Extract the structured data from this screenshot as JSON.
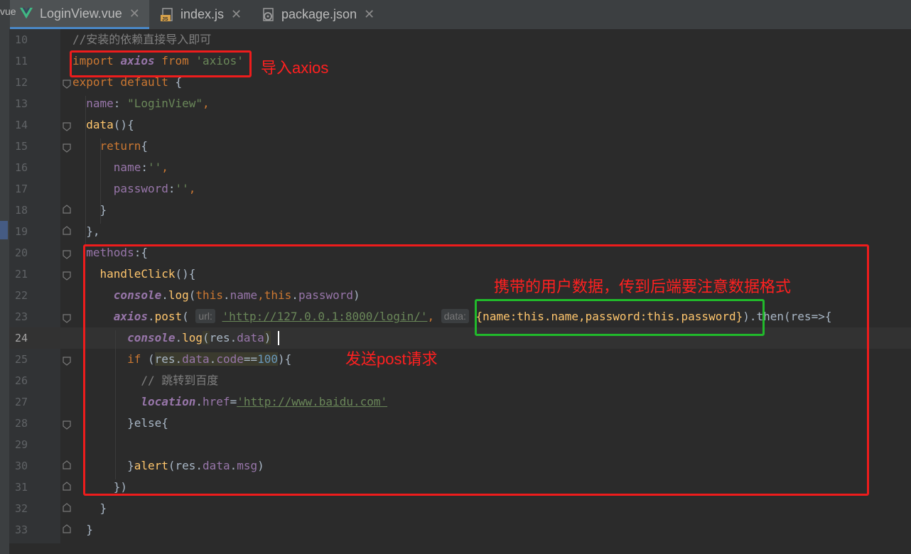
{
  "tabs": [
    {
      "label": "LoginView.vue",
      "icon": "vue-icon",
      "active": true
    },
    {
      "label": "index.js",
      "icon": "js-file-icon",
      "active": false
    },
    {
      "label": "package.json",
      "icon": "package-json-icon",
      "active": false
    }
  ],
  "left_strip_hint": "vue",
  "annotations": {
    "import_note": "导入axios",
    "data_note": "携带的用户数据，传到后端要注意数据格式",
    "post_note": "发送post请求"
  },
  "colors": {
    "annotation": "#ee1c1c",
    "green_box": "#21b92b",
    "accent": "#4a88c7"
  },
  "lines": [
    {
      "num": "10"
    },
    {
      "num": "11"
    },
    {
      "num": "12"
    },
    {
      "num": "13"
    },
    {
      "num": "14"
    },
    {
      "num": "15"
    },
    {
      "num": "16"
    },
    {
      "num": "17"
    },
    {
      "num": "18"
    },
    {
      "num": "19"
    },
    {
      "num": "20"
    },
    {
      "num": "21"
    },
    {
      "num": "22"
    },
    {
      "num": "23"
    },
    {
      "num": "24"
    },
    {
      "num": "25"
    },
    {
      "num": "26"
    },
    {
      "num": "27"
    },
    {
      "num": "28"
    },
    {
      "num": "29"
    },
    {
      "num": "30"
    },
    {
      "num": "31"
    },
    {
      "num": "32"
    },
    {
      "num": "33"
    }
  ],
  "code": {
    "l10": "//安装的依赖直接导入即可",
    "l11": [
      "import",
      "axios",
      "from",
      "'axios'"
    ],
    "l12": [
      "export",
      "default",
      "{"
    ],
    "l13": [
      "name",
      ": ",
      "\"LoginView\"",
      ","
    ],
    "l14": [
      "data",
      "(){"
    ],
    "l15": [
      "return",
      "{"
    ],
    "l16": [
      "name",
      ":",
      "''",
      ","
    ],
    "l17": [
      "password",
      ":",
      "''",
      ","
    ],
    "l18": "}",
    "l19": "},",
    "l20": [
      "methods",
      ":{"
    ],
    "l21": [
      "handleClick",
      "(){"
    ],
    "l22": [
      "console",
      ".",
      "log",
      "(",
      "this",
      ".",
      "name",
      ",",
      "this",
      ".",
      "password",
      ")"
    ],
    "l23": {
      "obj": "axios",
      "fn": "post",
      "url_hint": "url:",
      "url": "'http://127.0.0.1:8000/login/'",
      "data_hint": "data:",
      "body": "{name:this.name,password:this.password}",
      "then": ").then(res=>{"
    },
    "l24": [
      "console",
      ".",
      "log",
      "(",
      "res",
      ".",
      "data",
      ")"
    ],
    "l25": [
      "if",
      " (",
      "res",
      ".",
      "data",
      ".",
      "code",
      "==",
      "100",
      "){"
    ],
    "l26": "// 跳转到百度",
    "l27": [
      "location",
      ".",
      "href",
      "=",
      "'http://www.baidu.com'"
    ],
    "l28": "}else{",
    "l29": "",
    "l30": [
      "}",
      "alert",
      "(res.",
      "data",
      ".",
      "msg",
      ")"
    ],
    "l31": "})",
    "l32": "}",
    "l33": "}"
  }
}
